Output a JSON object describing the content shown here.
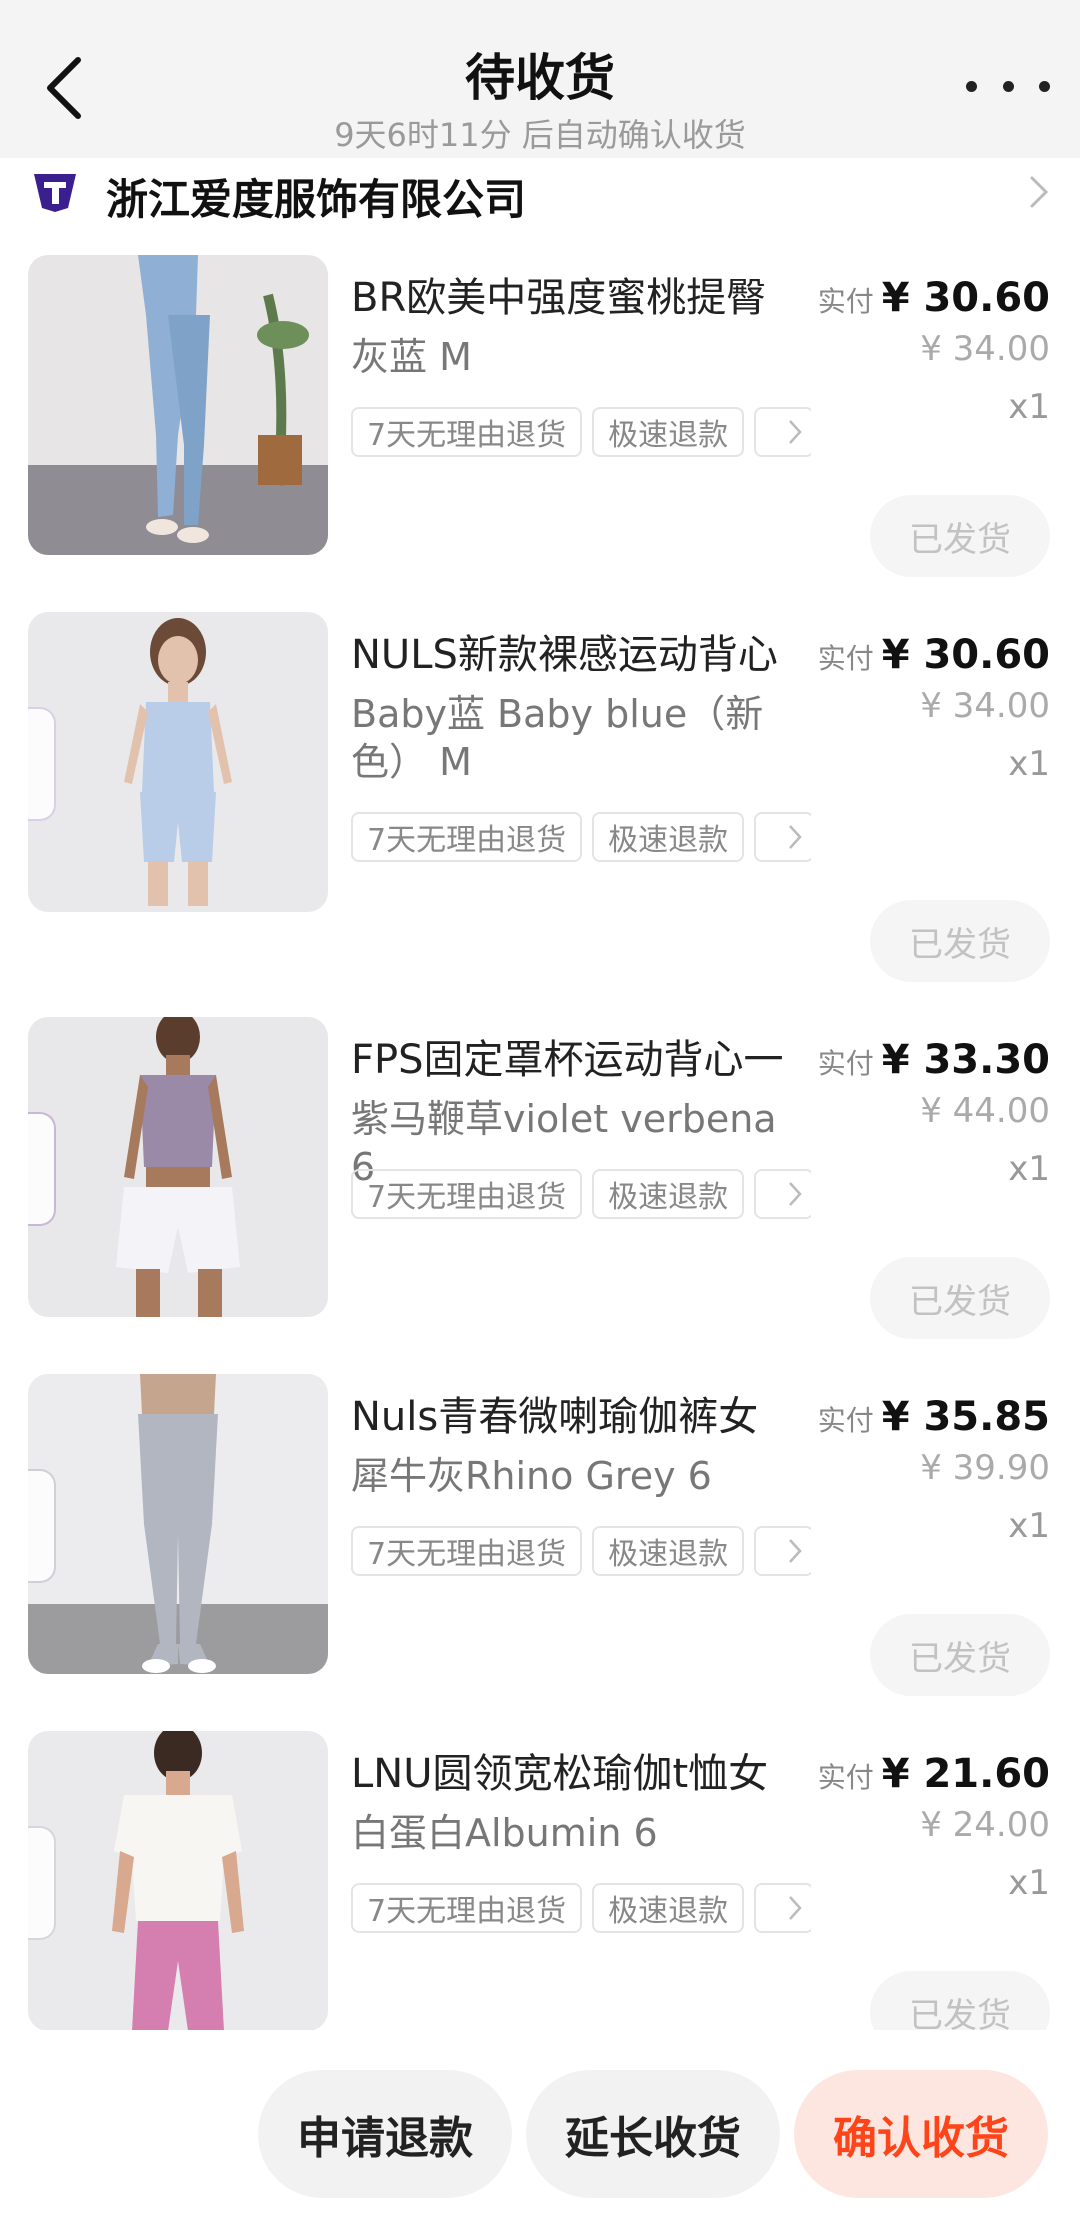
{
  "header": {
    "title": "待收货",
    "subtitle": "9天6时11分 后自动确认收货"
  },
  "shop": {
    "name": "浙江爱度服饰有限公司"
  },
  "labels": {
    "paid_label": "实付",
    "tag_return": "7天无理由退货",
    "tag_refund": "极速退款",
    "shipped": "已发货"
  },
  "items": [
    {
      "name": "BR欧美中强度蜜桃提臀",
      "spec": "灰蓝 M",
      "paid": "¥ 30.60",
      "original": "¥ 34.00",
      "qty": "x1"
    },
    {
      "name": "NULS新款裸感运动背心",
      "spec": "Baby蓝 Baby blue（新色） M",
      "paid": "¥ 30.60",
      "original": "¥ 34.00",
      "qty": "x1"
    },
    {
      "name": "FPS固定罩杯运动背心一",
      "spec": "紫马鞭草violet verbena 6",
      "paid": "¥ 33.30",
      "original": "¥ 44.00",
      "qty": "x1"
    },
    {
      "name": "Nuls青春微喇瑜伽裤女",
      "spec": "犀牛灰Rhino Grey 6",
      "paid": "¥ 35.85",
      "original": "¥ 39.90",
      "qty": "x1"
    },
    {
      "name": "LNU圆领宽松瑜伽t恤女",
      "spec": "白蛋白Albumin 6",
      "paid": "¥ 21.60",
      "original": "¥ 24.00",
      "qty": "x1"
    }
  ],
  "actions": {
    "refund": "申请退款",
    "extend": "延长收货",
    "confirm": "确认收货"
  },
  "colors": {
    "accent": "#ff4419",
    "accent_bg": "#fde6e0",
    "header_bg": "#f4f4f4"
  }
}
